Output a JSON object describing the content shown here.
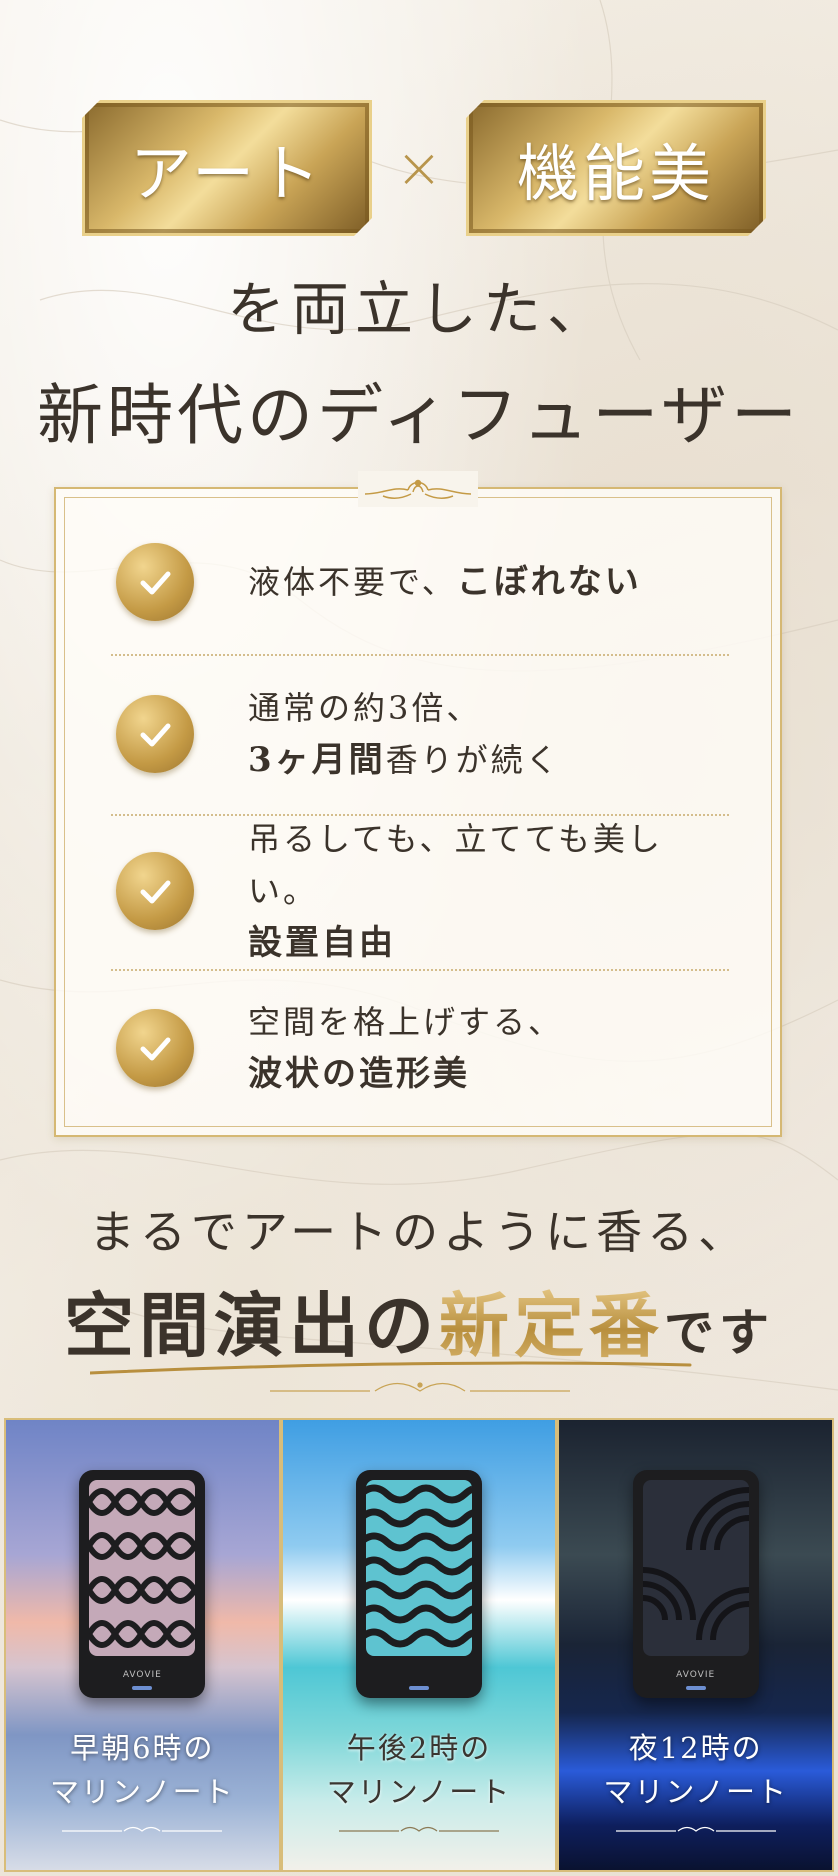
{
  "header": {
    "badge_left": "アート",
    "times": "×",
    "badge_right": "機能美"
  },
  "headline": {
    "line1": "を両立した、",
    "line2": "新時代のディフューザー"
  },
  "features": [
    {
      "plain": "液体不要で、",
      "bold": "こぼれない",
      "line2_bold": "",
      "line2_plain": ""
    },
    {
      "plain": "通常の約3倍、",
      "bold": "",
      "line2_bold": "3ヶ月間",
      "line2_plain": "香りが続く"
    },
    {
      "plain": "吊るしても、立てても美しい。",
      "bold": "",
      "line2_bold": "設置自由",
      "line2_plain": ""
    },
    {
      "plain": "空間を格上げする、",
      "bold": "",
      "line2_bold": "波状の造形美",
      "line2_plain": ""
    }
  ],
  "tagline": {
    "line1": "まるでアートのように香る、",
    "part_a": "空間演出の",
    "part_gold": "新定番",
    "part_b": "です"
  },
  "panels": [
    {
      "line1": "早朝6時の",
      "line2": "マリンノート",
      "brand": "AVOVIE"
    },
    {
      "line1": "午後2時の",
      "line2": "マリンノート",
      "brand": ""
    },
    {
      "line1": "夜12時の",
      "line2": "マリンノート",
      "brand": "AVOVIE"
    }
  ],
  "colors": {
    "gold": "#c49a45",
    "text": "#3b332b",
    "background": "#f3eee6"
  },
  "icons": [
    "check-icon",
    "ornament-icon"
  ]
}
